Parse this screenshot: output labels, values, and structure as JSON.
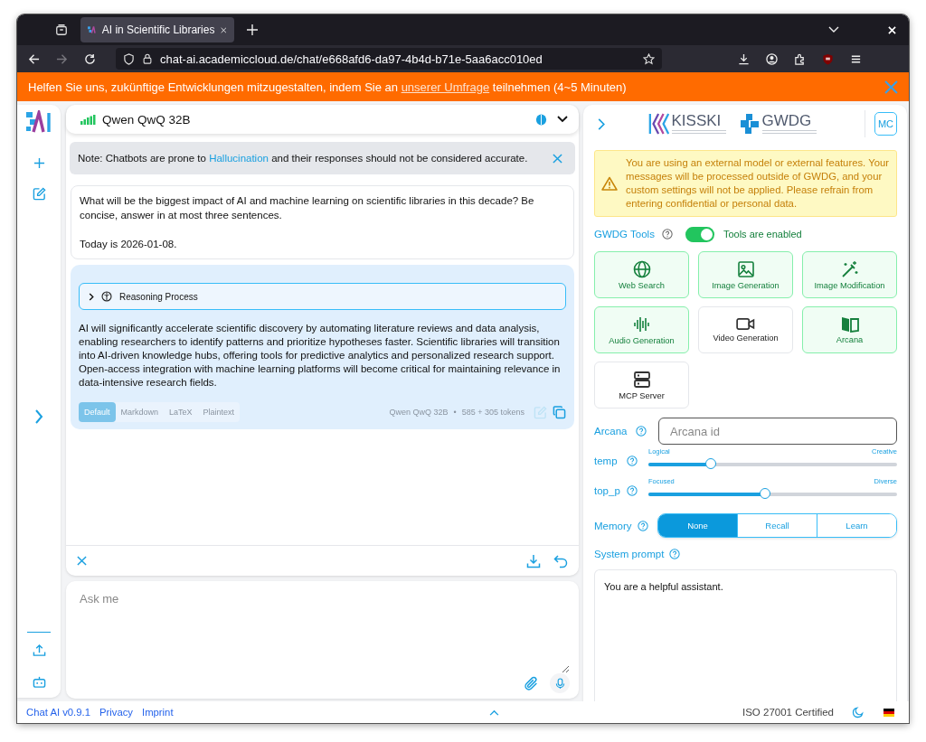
{
  "browser": {
    "tab_title": "AI in Scientific Libraries",
    "url": "chat-ai.academiccloud.de/chat/e668afd6-da97-4b4d-b71e-5aa6acc010ed"
  },
  "banner": {
    "text_before": "Helfen Sie uns, zukünftige Entwicklungen mitzugestalten, indem Sie an",
    "link": "unserer Umfrage",
    "text_after": "teilnehmen (4~5 Minuten)"
  },
  "model": {
    "name": "Qwen QwQ 32B"
  },
  "note": {
    "text_before": "Note: Chatbots are prone to",
    "link": "Hallucination",
    "text_after": "and their responses should not be considered accurate."
  },
  "messages": [
    {
      "kind": "user",
      "text": "What will be the biggest impact of AI and machine learning on scientific libraries in this decade? Be concise, answer in at most three sentences.\n\nToday is 2026-01-08."
    },
    {
      "kind": "assistant",
      "reasoning_label": "Reasoning Process",
      "text": "AI will significantly accelerate scientific discovery by automating literature reviews and data analysis, enabling researchers to identify patterns and prioritize hypotheses faster. Scientific libraries will transition into AI-driven knowledge hubs, offering tools for predictive analytics and personalized research support. Open-access integration with machine learning platforms will become critical for maintaining relevance in data-intensive research fields.",
      "formats": [
        {
          "label": "Default",
          "selected": true
        },
        {
          "label": "Markdown",
          "selected": false
        },
        {
          "label": "LaTeX",
          "selected": false
        },
        {
          "label": "Plaintext",
          "selected": false
        }
      ],
      "meta_model": "Qwen QwQ 32B",
      "meta_separator": "•",
      "meta_tokens": "585 + 305 tokens"
    }
  ],
  "input": {
    "placeholder": "Ask me"
  },
  "panel": {
    "avatar": "MC",
    "logos": [
      {
        "name": "KISSKI"
      },
      {
        "name": "GWDG"
      }
    ],
    "warning": "You are using an external model or external features. Your messages will be processed outside of GWDG, and your custom settings will not be applied. Please refrain from entering confidential or personal data.",
    "tools_toggle": {
      "label": "GWDG Tools",
      "on": true,
      "status": "Tools are enabled"
    },
    "tools": [
      {
        "label": "Web Search",
        "selected": true
      },
      {
        "label": "Image Generation",
        "selected": true
      },
      {
        "label": "Image Modification",
        "selected": true
      },
      {
        "label": "Audio Generation",
        "selected": true
      },
      {
        "label": "Video Generation",
        "selected": false
      },
      {
        "label": "Arcana",
        "selected": true
      },
      {
        "label": "MCP Server",
        "selected": false
      }
    ],
    "arcana": {
      "label": "Arcana",
      "placeholder": "Arcana id"
    },
    "sliders": [
      {
        "label": "temp",
        "min_label": "Logical",
        "max_label": "Creative",
        "level": 0.25
      },
      {
        "label": "top_p",
        "min_label": "Focused",
        "max_label": "Diverse",
        "level": 0.47
      }
    ],
    "memory": {
      "label": "Memory",
      "options": [
        {
          "label": "None",
          "selected": true
        },
        {
          "label": "Recall",
          "selected": false
        },
        {
          "label": "Learn",
          "selected": false
        }
      ]
    },
    "system_prompt": {
      "label": "System prompt",
      "value": "You are a helpful assistant."
    }
  },
  "footer": {
    "links": [
      "Chat AI v0.9.1",
      "Privacy",
      "Imprint"
    ],
    "certification": "ISO 27001 Certified"
  }
}
